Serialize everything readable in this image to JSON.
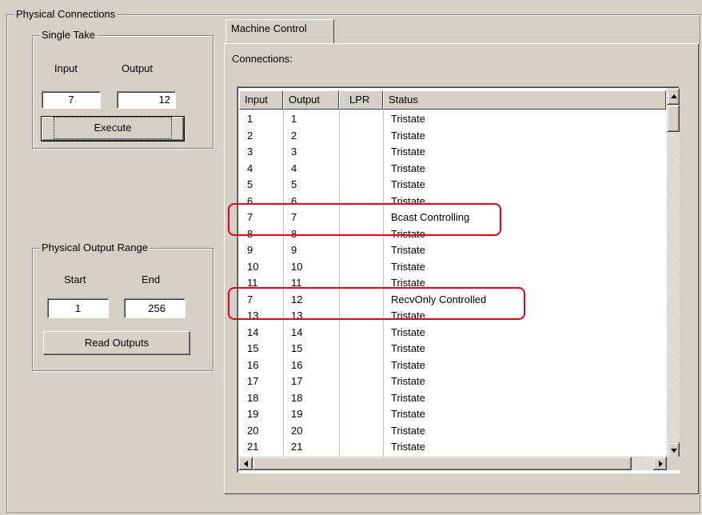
{
  "physical_connections": {
    "title": "Physical Connections",
    "single_take": {
      "title": "Single Take",
      "input_label": "Input",
      "output_label": "Output",
      "input_value": "7",
      "output_value": "12",
      "execute_label": "Execute"
    },
    "output_range": {
      "title": "Physical Output Range",
      "start_label": "Start",
      "end_label": "End",
      "start_value": "1",
      "end_value": "256",
      "read_label": "Read Outputs"
    }
  },
  "tab": {
    "label": "Machine Control",
    "connections_label": "Connections:"
  },
  "list": {
    "columns": [
      "Input",
      "Output",
      "LPR",
      "Status"
    ],
    "rows": [
      {
        "input": "1",
        "output": "1",
        "lpr": "",
        "status": "Tristate"
      },
      {
        "input": "2",
        "output": "2",
        "lpr": "",
        "status": "Tristate"
      },
      {
        "input": "3",
        "output": "3",
        "lpr": "",
        "status": "Tristate"
      },
      {
        "input": "4",
        "output": "4",
        "lpr": "",
        "status": "Tristate"
      },
      {
        "input": "5",
        "output": "5",
        "lpr": "",
        "status": "Tristate"
      },
      {
        "input": "6",
        "output": "6",
        "lpr": "",
        "status": "Tristate"
      },
      {
        "input": "7",
        "output": "7",
        "lpr": "",
        "status": "Bcast Controlling"
      },
      {
        "input": "8",
        "output": "8",
        "lpr": "",
        "status": "Tristate"
      },
      {
        "input": "9",
        "output": "9",
        "lpr": "",
        "status": "Tristate"
      },
      {
        "input": "10",
        "output": "10",
        "lpr": "",
        "status": "Tristate"
      },
      {
        "input": "11",
        "output": "11",
        "lpr": "",
        "status": "Tristate"
      },
      {
        "input": "7",
        "output": "12",
        "lpr": "",
        "status": "RecvOnly Controlled"
      },
      {
        "input": "13",
        "output": "13",
        "lpr": "",
        "status": "Tristate"
      },
      {
        "input": "14",
        "output": "14",
        "lpr": "",
        "status": "Tristate"
      },
      {
        "input": "15",
        "output": "15",
        "lpr": "",
        "status": "Tristate"
      },
      {
        "input": "16",
        "output": "16",
        "lpr": "",
        "status": "Tristate"
      },
      {
        "input": "17",
        "output": "17",
        "lpr": "",
        "status": "Tristate"
      },
      {
        "input": "18",
        "output": "18",
        "lpr": "",
        "status": "Tristate"
      },
      {
        "input": "19",
        "output": "19",
        "lpr": "",
        "status": "Tristate"
      },
      {
        "input": "20",
        "output": "20",
        "lpr": "",
        "status": "Tristate"
      },
      {
        "input": "21",
        "output": "21",
        "lpr": "",
        "status": "Tristate"
      }
    ]
  },
  "highlight_color": "#e0001a"
}
